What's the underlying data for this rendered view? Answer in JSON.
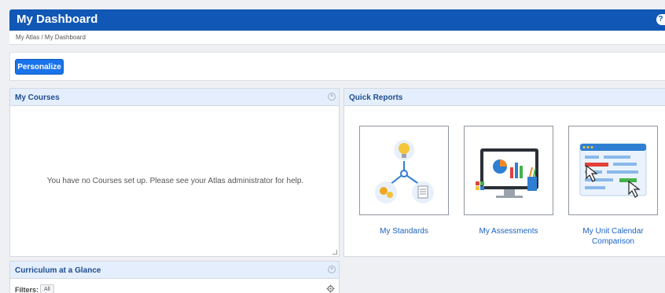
{
  "header": {
    "title": "My Dashboard",
    "help_label": "?"
  },
  "breadcrumb": {
    "text": "My Atlas / My Dashboard"
  },
  "toolbar": {
    "personalize_label": "Personalize"
  },
  "courses": {
    "title": "My Courses",
    "empty_message": "You have no Courses set up. Please see your Atlas administrator for help."
  },
  "reports": {
    "title": "Quick Reports",
    "items": [
      {
        "label": "My Standards",
        "icon": "standards-network-icon"
      },
      {
        "label": "My Assessments",
        "icon": "assessments-monitor-icon"
      },
      {
        "label": "My Unit Calendar Comparison",
        "icon": "calendar-comparison-icon"
      }
    ]
  },
  "glance": {
    "title": "Curriculum at a Glance",
    "filters_label": "Filters:",
    "filter_value": "All"
  },
  "colors": {
    "brand": "#1157b5",
    "button": "#1a73e8",
    "panel_header": "#e4eefc",
    "link": "#1a62c4"
  }
}
